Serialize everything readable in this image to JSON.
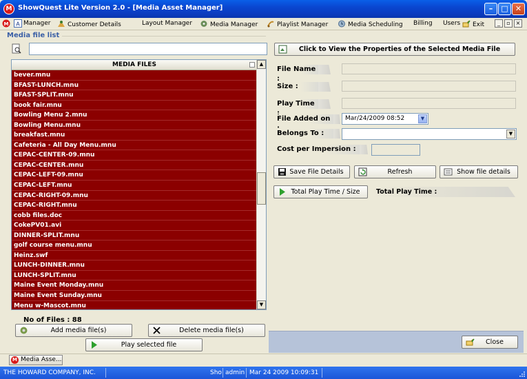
{
  "window": {
    "title": "ShowQuest Lite Version 2.0 - [Media Asset Manager]",
    "minimize": "–",
    "maximize": "□",
    "close": "✕"
  },
  "menubar": {
    "items": [
      "Manager",
      "Customer Details",
      "Layout Manager",
      "Media Manager",
      "Playlist Manager",
      "Media Scheduling",
      "Billing",
      "Users",
      "Exit"
    ],
    "mdi_minimize": "_",
    "mdi_restore": "▫",
    "mdi_close": "×"
  },
  "left": {
    "group_title": "Media file list",
    "search_value": "",
    "list_header": "MEDIA FILES",
    "files": [
      "bever.mnu",
      "BFAST-LUNCH.mnu",
      "BFAST-SPLIT.mnu",
      "book fair.mnu",
      "Bowling Menu 2.mnu",
      "Bowling Menu.mnu",
      "breakfast.mnu",
      "Cafeteria - All Day Menu.mnu",
      "CEPAC-CENTER-09.mnu",
      "CEPAC-CENTER.mnu",
      "CEPAC-LEFT-09.mnu",
      "CEPAC-LEFT.mnu",
      "CEPAC-RIGHT-09.mnu",
      "CEPAC-RIGHT.mnu",
      "cobb files.doc",
      "CokePV01.avi",
      "DINNER-SPLIT.mnu",
      "golf course menu.mnu",
      "Heinz.swf",
      "LUNCH-DINNER.mnu",
      "LUNCH-SPLIT.mnu",
      "Maine Event Monday.mnu",
      "Maine Event Sunday.mnu",
      "Menu w-Mascot.mnu"
    ],
    "file_count_label": "No of Files : 88",
    "add_button": "Add media file(s)",
    "delete_button": "Delete media file(s)",
    "play_button": "Play selected file"
  },
  "right": {
    "props_button": "Click to View the Properties of the Selected Media File",
    "file_name_label": "File Name :",
    "size_label": "Size :",
    "play_time_label": "Play Time :",
    "file_added_label": "File Added on :",
    "file_added_value": "Mar/24/2009 08:52",
    "belongs_to_label": "Belongs To :",
    "belongs_to_value": "",
    "cost_label": "Cost per Impersion :",
    "save_button": "Save File Details",
    "refresh_button": "Refresh",
    "show_details_button": "Show file details",
    "total_play_button": "Total Play Time / Size",
    "total_play_label": "Total Play Time :",
    "close_button": "Close"
  },
  "taskbar": {
    "task_label": "Media Asse..."
  },
  "status": {
    "company": "THE HOWARD COMPANY, INC.",
    "app_abbr": "Sho",
    "user": "admin",
    "datetime": "Mar 24 2009 10:09:31"
  },
  "colors": {
    "list_bg": "#8b0000",
    "title_blue": "#0a46d0",
    "status_blue": "#1b55d8"
  }
}
